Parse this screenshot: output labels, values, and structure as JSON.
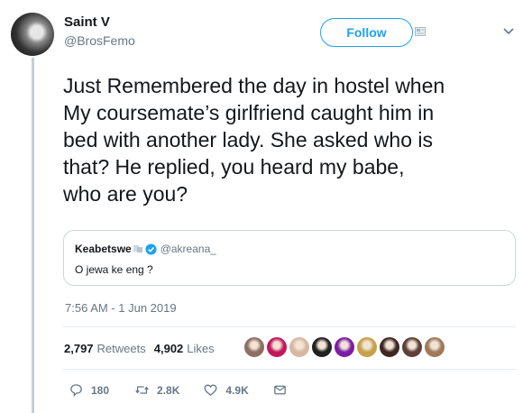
{
  "author": {
    "name": "Saint V",
    "handle": "@BrosFemo"
  },
  "follow_label": "Follow",
  "tweet": {
    "lines": [
      "Just Remembered the day in hostel when",
      "My coursemate’s girlfriend caught him in",
      "bed with another lady. She asked who is",
      "that? He replied, you heard my babe,",
      "who are you?"
    ]
  },
  "quote": {
    "name": "Keabetswe",
    "handle": "@akreana_",
    "text": "O jewa ke eng ?"
  },
  "timestamp": "7:56 AM - 1 Jun 2019",
  "stats": {
    "retweets_count": "2,797",
    "retweets_label": "Retweets",
    "likes_count": "4,902",
    "likes_label": "Likes"
  },
  "liker_colors": [
    "#8d6e63",
    "#c2185b",
    "#d7b8a0",
    "#212121",
    "#7b1fa2",
    "#c6a14a",
    "#3e2723",
    "#5d4037",
    "#9e7a5a"
  ],
  "actions": {
    "replies": "180",
    "retweets": "2.8K",
    "likes": "4.9K"
  },
  "colors": {
    "accent": "#1da1f2",
    "muted": "#657786",
    "text": "#14171a",
    "thread": "#c4cfd6"
  },
  "icons": [
    "reply-icon",
    "retweet-icon",
    "like-icon",
    "dm-icon",
    "chevron-down-icon",
    "verified-icon"
  ]
}
